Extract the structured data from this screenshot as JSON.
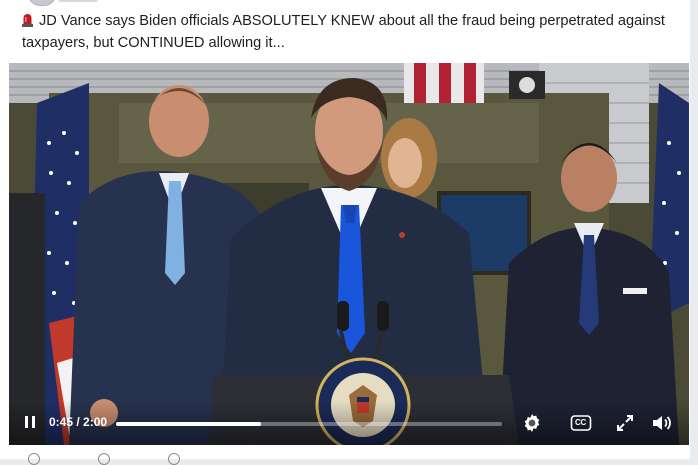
{
  "post": {
    "text": "JD Vance says Biden officials ABSOLUTELY KNEW about all the fraud being perpetrated against taxpayers, but CONTINUED allowing it..."
  },
  "video": {
    "current_time": "0:45",
    "duration": "2:00",
    "progress": 0.375
  },
  "icons": {
    "siren": "siren-icon",
    "pause": "pause-icon",
    "settings": "gear-icon",
    "captions": "closed-captions-icon",
    "fullscreen": "fullscreen-icon",
    "volume": "volume-icon"
  },
  "captions_label": "CC",
  "colors": {
    "siren": "#c0191f",
    "tie": "#1a56db",
    "suit": "#222d44"
  }
}
